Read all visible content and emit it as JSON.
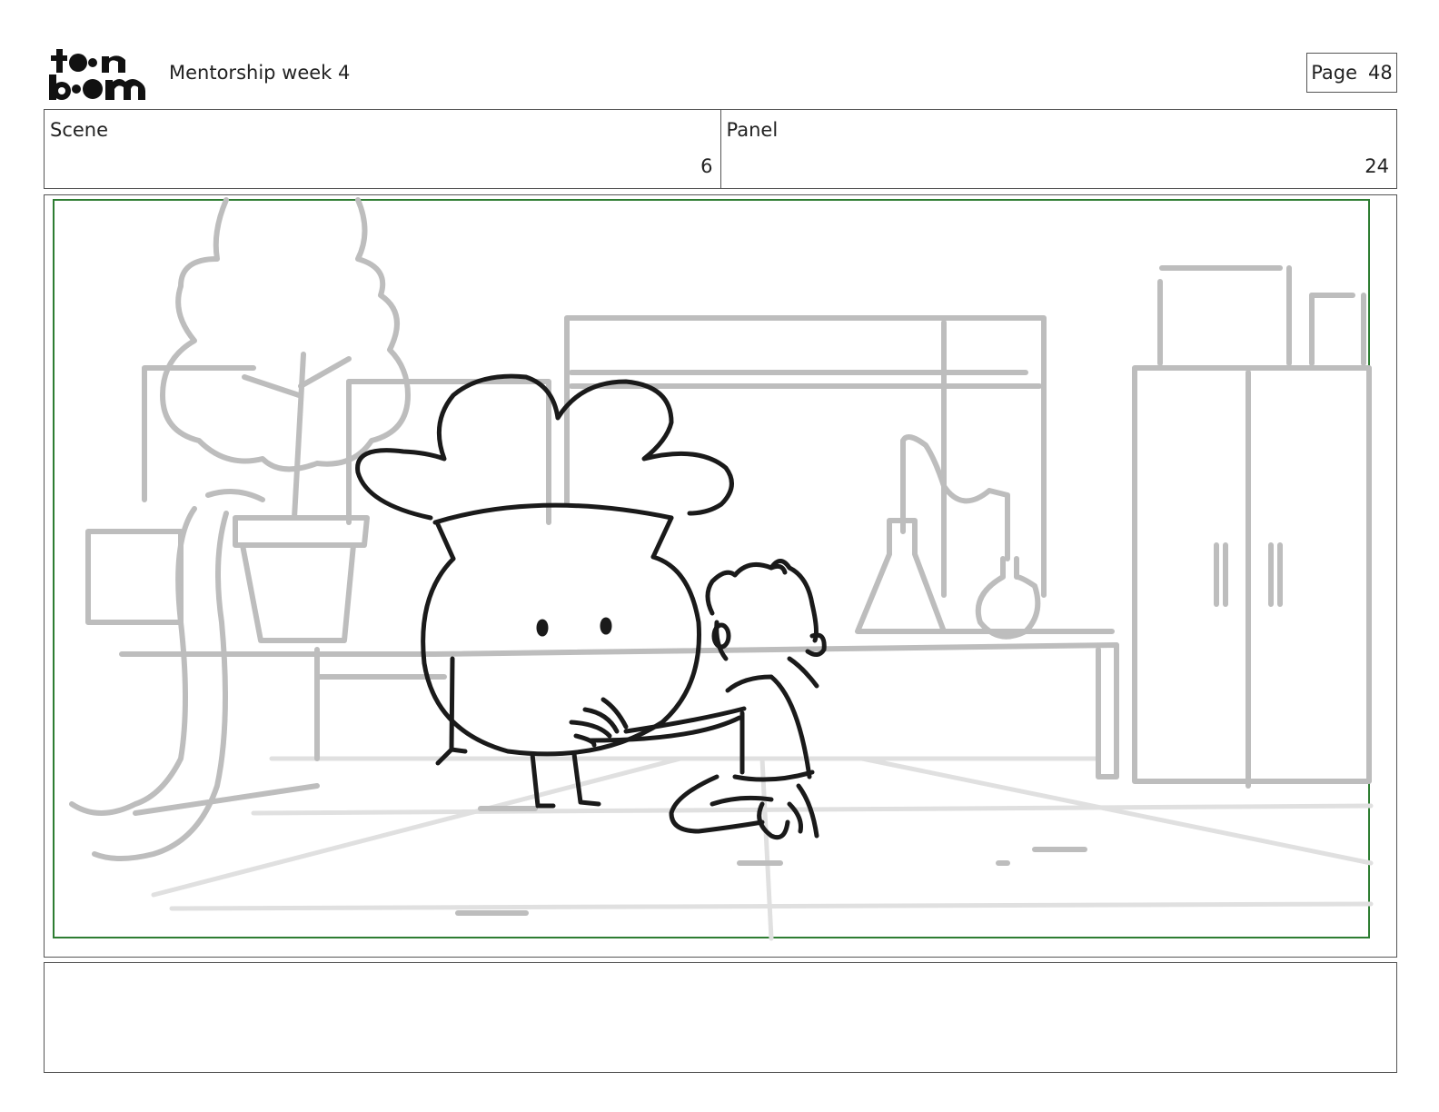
{
  "header": {
    "logo_text": "toon boom",
    "title": "Mentorship week 4",
    "page_label": "Page",
    "page_number": "48"
  },
  "info": {
    "scene_label": "Scene",
    "scene_value": "6",
    "panel_label": "Panel",
    "panel_value": "24"
  },
  "panel": {
    "frame_color": "#2e7d32",
    "sketch_color": "#1a1a1a",
    "background_color": "#bdbdbd"
  },
  "notes": {
    "text": ""
  }
}
